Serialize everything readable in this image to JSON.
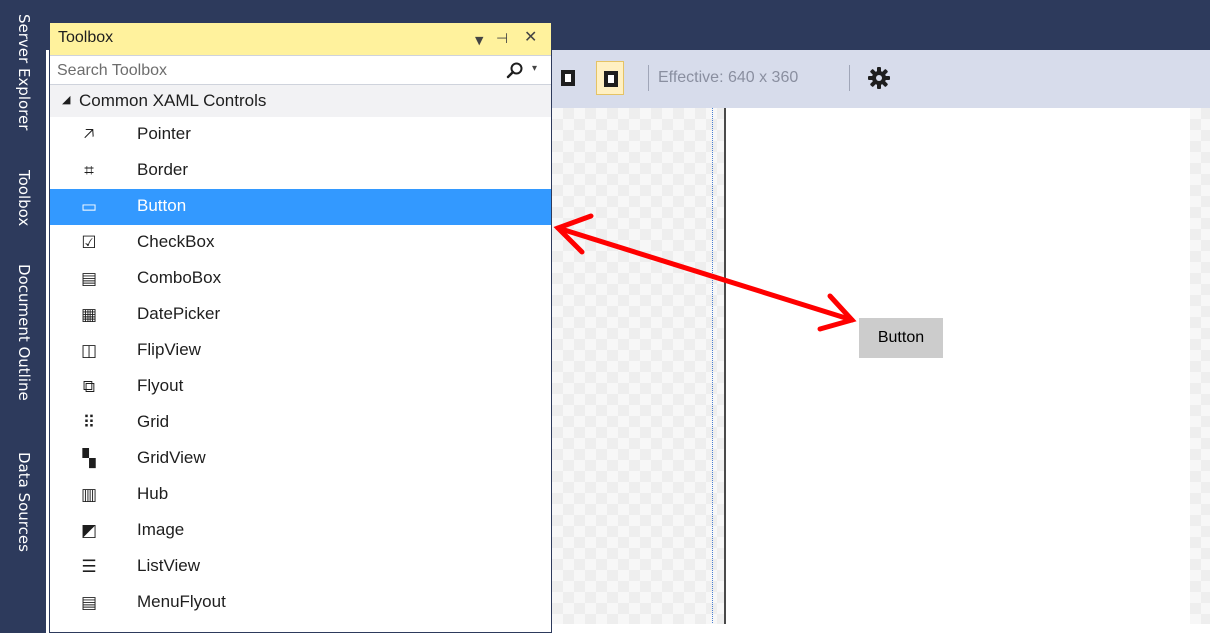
{
  "side_tabs": [
    "Server Explorer",
    "Toolbox",
    "Document Outline",
    "Data Sources"
  ],
  "toolbox": {
    "title": "Toolbox",
    "search_placeholder": "Search Toolbox",
    "category": "Common XAML Controls",
    "items": [
      {
        "label": "Pointer",
        "icon": "pointer-icon",
        "glyph": "🡥"
      },
      {
        "label": "Border",
        "icon": "border-icon",
        "glyph": "⌗"
      },
      {
        "label": "Button",
        "icon": "button-icon",
        "glyph": "▭",
        "selected": true
      },
      {
        "label": "CheckBox",
        "icon": "checkbox-icon",
        "glyph": "☑"
      },
      {
        "label": "ComboBox",
        "icon": "combobox-icon",
        "glyph": "▤"
      },
      {
        "label": "DatePicker",
        "icon": "datepicker-icon",
        "glyph": "▦"
      },
      {
        "label": "FlipView",
        "icon": "flipview-icon",
        "glyph": "◫"
      },
      {
        "label": "Flyout",
        "icon": "flyout-icon",
        "glyph": "⧉"
      },
      {
        "label": "Grid",
        "icon": "grid-icon",
        "glyph": "⠿"
      },
      {
        "label": "GridView",
        "icon": "gridview-icon",
        "glyph": "▚"
      },
      {
        "label": "Hub",
        "icon": "hub-icon",
        "glyph": "▥"
      },
      {
        "label": "Image",
        "icon": "image-icon",
        "glyph": "◩"
      },
      {
        "label": "ListView",
        "icon": "listview-icon",
        "glyph": "☰"
      },
      {
        "label": "MenuFlyout",
        "icon": "menuflyout-icon",
        "glyph": "▤"
      }
    ]
  },
  "designer": {
    "effective_size": "Effective: 640 x 360",
    "button_label": "Button"
  },
  "colors": {
    "dark_chrome": "#2d3a5c",
    "toolbox_header": "#fff29d",
    "selection": "#3399ff",
    "arrow": "#ff0000"
  }
}
